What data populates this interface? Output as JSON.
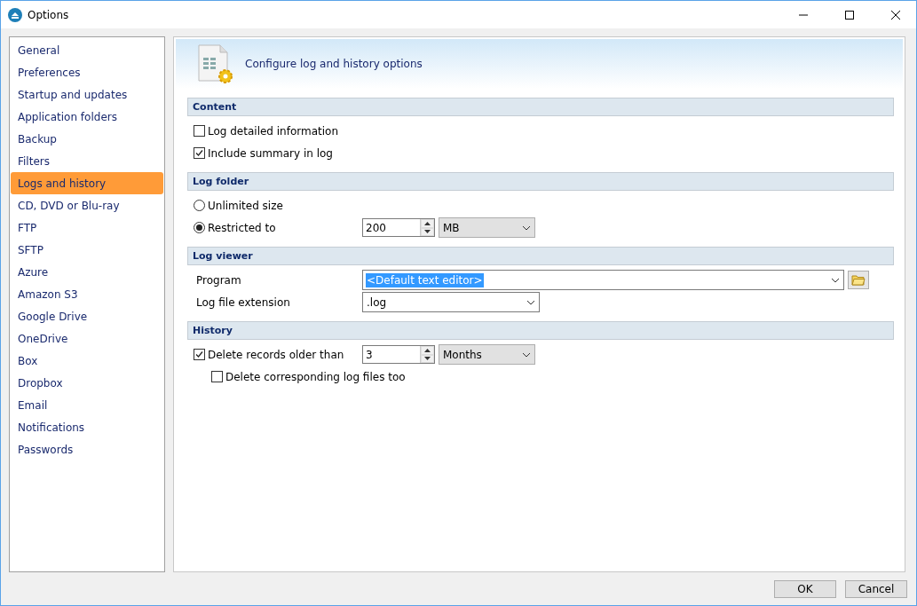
{
  "window": {
    "title": "Options"
  },
  "sidebar": {
    "items": [
      {
        "label": "General",
        "selected": false
      },
      {
        "label": "Preferences",
        "selected": false
      },
      {
        "label": "Startup and updates",
        "selected": false
      },
      {
        "label": "Application folders",
        "selected": false
      },
      {
        "label": "Backup",
        "selected": false
      },
      {
        "label": "Filters",
        "selected": false
      },
      {
        "label": "Logs and history",
        "selected": true
      },
      {
        "label": "CD, DVD or Blu-ray",
        "selected": false
      },
      {
        "label": "FTP",
        "selected": false
      },
      {
        "label": "SFTP",
        "selected": false
      },
      {
        "label": "Azure",
        "selected": false
      },
      {
        "label": "Amazon S3",
        "selected": false
      },
      {
        "label": "Google Drive",
        "selected": false
      },
      {
        "label": "OneDrive",
        "selected": false
      },
      {
        "label": "Box",
        "selected": false
      },
      {
        "label": "Dropbox",
        "selected": false
      },
      {
        "label": "Email",
        "selected": false
      },
      {
        "label": "Notifications",
        "selected": false
      },
      {
        "label": "Passwords",
        "selected": false
      }
    ]
  },
  "header": {
    "title": "Configure log and history options"
  },
  "sections": [
    {
      "title": "Content",
      "rows": [
        {
          "kind": "checkbox",
          "label": "Log detailed information",
          "checked": false
        },
        {
          "kind": "checkbox",
          "label": "Include summary in log",
          "checked": true
        }
      ]
    },
    {
      "title": "Log folder",
      "rows": [
        {
          "kind": "radio",
          "label": "Unlimited size",
          "selected": false
        },
        {
          "kind": "radio",
          "label": "Restricted to",
          "selected": true,
          "spin": {
            "value": "200"
          },
          "combo": {
            "value": "MB",
            "editable": false,
            "text_selected": false
          }
        }
      ]
    },
    {
      "title": "Log viewer",
      "rows": [
        {
          "kind": "field",
          "label": "Program",
          "combo": {
            "value": "<Default text editor>",
            "editable": true,
            "text_selected": true,
            "wide": true
          },
          "browse": true
        },
        {
          "kind": "field",
          "label": "Log file extension",
          "combo": {
            "value": ".log",
            "editable": true,
            "text_selected": false,
            "wide": false
          },
          "browse": false
        }
      ]
    },
    {
      "title": "History",
      "rows": [
        {
          "kind": "checkbox",
          "label": "Delete records older than",
          "checked": true,
          "spin": {
            "value": "3"
          },
          "combo": {
            "value": "Months",
            "editable": false,
            "text_selected": false
          },
          "children": [
            {
              "kind": "checkbox",
              "label": "Delete corresponding log files too",
              "checked": false
            }
          ]
        }
      ]
    }
  ],
  "buttons": [
    "OK",
    "Cancel"
  ]
}
